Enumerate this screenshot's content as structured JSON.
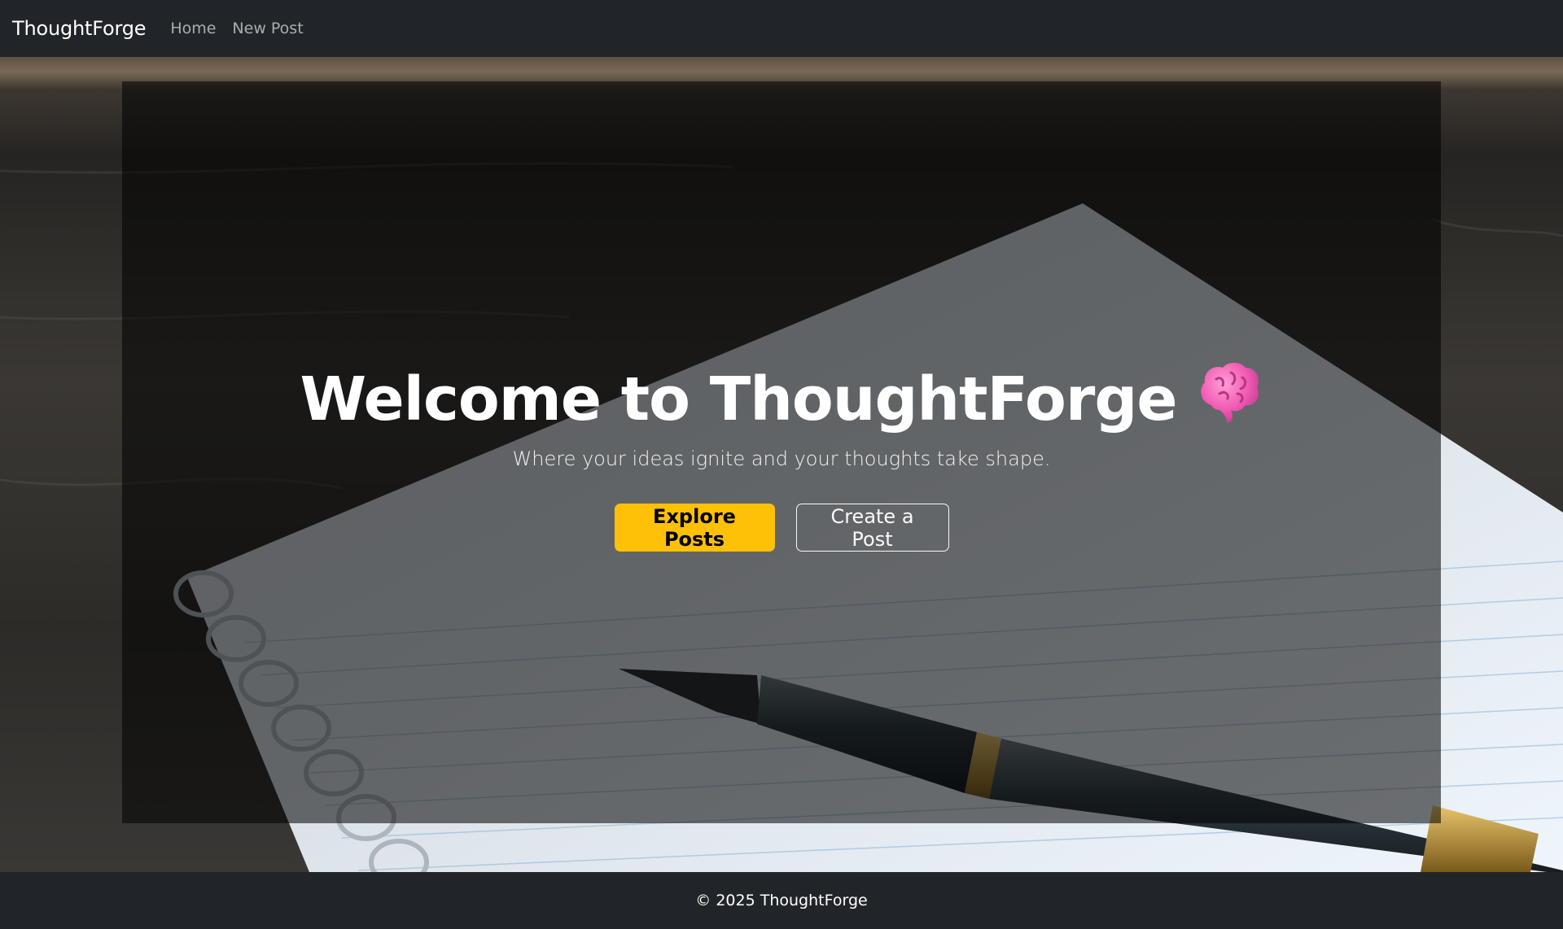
{
  "navbar": {
    "brand": "ThoughtForge",
    "links": [
      {
        "label": "Home"
      },
      {
        "label": "New Post"
      }
    ]
  },
  "hero": {
    "title": "Welcome to ThoughtForge",
    "title_icon": "brain-icon",
    "subtitle": "Where your ideas ignite and your thoughts take shape.",
    "buttons": {
      "primary_label": "Explore Posts",
      "secondary_label": "Create a Post"
    }
  },
  "footer": {
    "text": "© 2025 ThoughtForge"
  },
  "colors": {
    "navbar_bg": "#212529",
    "primary_button": "#ffc107",
    "text_light": "#ffffff"
  }
}
